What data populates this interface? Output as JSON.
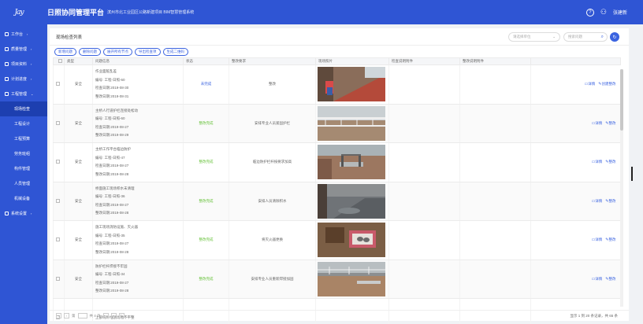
{
  "header": {
    "logo_text": "Jay",
    "title": "日照协同管理平台",
    "subtitle": "滨州市北工业园区公路新建项目 BIM智慧管理系统",
    "help_icon": "help-circle-icon",
    "user_icon": "user-icon",
    "user_name": "张建新"
  },
  "sidebar": {
    "items": [
      {
        "label": "工作台",
        "chev": "›"
      },
      {
        "label": "质量管理",
        "chev": "›"
      },
      {
        "label": "项目资料",
        "chev": "›"
      },
      {
        "label": "计划进度",
        "chev": "›"
      },
      {
        "label": "工程管理",
        "chev": "⌄"
      },
      {
        "label": "现场检查"
      },
      {
        "label": "工程设计"
      },
      {
        "label": "工程预算"
      },
      {
        "label": "劳务班组"
      },
      {
        "label": "构件管理"
      },
      {
        "label": "人员管理"
      },
      {
        "label": "机械设备"
      },
      {
        "label": "系统设置",
        "chev": "›"
      }
    ]
  },
  "main": {
    "page_title": "现场检查列表",
    "unit_select": {
      "placeholder": "请选择单位",
      "arrow": "⌄"
    },
    "search": {
      "placeholder": "搜索问题",
      "icon": "search-icon"
    },
    "refresh_icon": "refresh-icon",
    "toolbar": [
      "新增问题",
      "删除问题",
      "展开所有节点",
      "导出检查项",
      "生成二维码"
    ],
    "columns": [
      "",
      "类型",
      "问题信息",
      "状态",
      "整改要求",
      "现场照片",
      "检查说明附件",
      "整改说明附件",
      ""
    ],
    "rows": [
      {
        "type": "安全",
        "info": [
          "作业面脏乱差",
          "编号: 工程-日照-60",
          "检查日期:2019-08-30",
          "整改日期:2019-08-31"
        ],
        "status": "未完成",
        "status_kind": "red",
        "requirement": "整改",
        "photo": "stair",
        "ops": [
          "详情",
          "创建整改"
        ]
      },
      {
        "type": "安全",
        "info": [
          "主桥人行道护栏连接处松动",
          "编号: 工程-日照-60",
          "检查日期:2019-08-27",
          "整改日期:2019-08-29"
        ],
        "status": "整改完成",
        "status_kind": "green",
        "requirement": "安排专业人员紧固护栏",
        "photo": "railing",
        "ops": [
          "详情",
          "整改"
        ]
      },
      {
        "type": "安全",
        "info": [
          "主桥工作平台临边防护",
          "编号: 工程-日照-47",
          "检查日期:2019-08-27",
          "整改日期:2019-08-28"
        ],
        "status": "整改完成",
        "status_kind": "green",
        "requirement": "临边防护栏杆按要求加高",
        "photo": "platform",
        "ops": [
          "详情",
          "整改"
        ]
      },
      {
        "type": "安全",
        "info": [
          "桥面施工现场积水未清理",
          "编号: 工程-日照-36",
          "检查日期:2019-08-27",
          "整改日期:2019-08-28"
        ],
        "status": "整改完成",
        "status_kind": "green",
        "requirement": "安排人员清除积水",
        "photo": "deck",
        "ops": [
          "详情",
          "整改"
        ]
      },
      {
        "type": "安全",
        "info": [
          "施工现场消防设施、灭火器",
          "编号: 工程-日照-35",
          "检查日期:2019-08-27",
          "整改日期:2019-08-28"
        ],
        "status": "整改完成",
        "status_kind": "green",
        "requirement": "将灭火器更换",
        "photo": "extinguisher",
        "ops": [
          "详情",
          "整改"
        ]
      },
      {
        "type": "安全",
        "info": [
          "防护栏杆焊接不牢固",
          "编号: 工程-日照-34",
          "检查日期:2019-08-27",
          "整改日期:2019-08-28"
        ],
        "status": "整改完成",
        "status_kind": "green",
        "requirement": "安排专业人员重新焊接加固",
        "photo": "site",
        "ops": [
          "详情",
          "整改"
        ]
      },
      {
        "type": "",
        "info": [
          "上部构件堆放场地不平整"
        ],
        "status": "",
        "status_kind": "",
        "requirement": "",
        "photo": "",
        "ops": []
      }
    ],
    "pager": {
      "first": "«",
      "prev": "‹",
      "page_label": "第",
      "page_value": "1",
      "of_label": "共 4 页",
      "next": "›",
      "last": "»",
      "refresh": "↻",
      "summary": "显示 1 到 20 条记录，共 65 条"
    }
  }
}
